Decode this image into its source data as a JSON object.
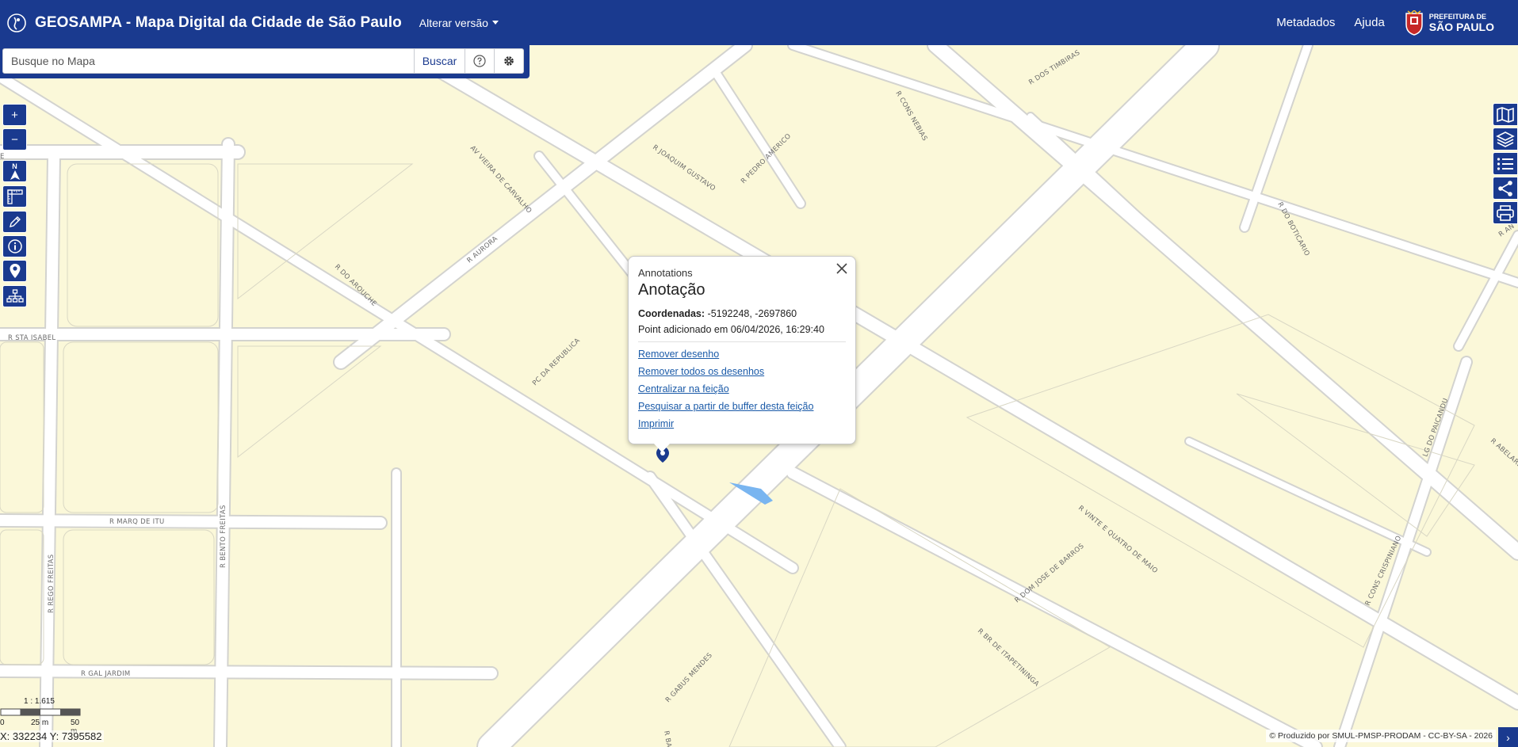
{
  "header": {
    "title": "GEOSAMPA - Mapa Digital da Cidade de São Paulo",
    "version_menu": "Alterar versão",
    "nav": {
      "metadados": "Metadados",
      "ajuda": "Ajuda"
    },
    "logo_line1": "PREFEITURA DE",
    "logo_line2": "SÃO PAULO",
    "brand_color": "#1a3a8f"
  },
  "search": {
    "placeholder": "Busque no Mapa",
    "button_label": "Buscar",
    "help_icon": "question-circle-icon",
    "settings_icon": "gear-icon"
  },
  "toolbar_left": {
    "zoom_in": "+",
    "zoom_out": "−",
    "north_label": "N",
    "tools": [
      "north-arrow-icon",
      "ruler-icon",
      "pencil-icon",
      "info-icon",
      "map-pin-icon",
      "sitemap-icon"
    ]
  },
  "toolbar_right": {
    "tools": [
      "map-icon",
      "layers-icon",
      "list-icon",
      "share-icon",
      "printer-icon"
    ]
  },
  "streets": [
    "R CONS NEBIAS",
    "R DOS TIMBIRAS",
    "AV VIEIRA DE CARVALHO",
    "R JOAQUIM GUSTAVO",
    "R PEDRO AMERICO",
    "R AURORA",
    "R DO AROUCHE",
    "R STA ISABEL",
    "PC DA REPUBLICA",
    "R DO BOTICARIO",
    "R MARQ DE ITU",
    "R BENTO FREITAS",
    "R REGO FREITAS",
    "R GAL JARDIM",
    "R GABUS MENDES",
    "R DOM JOSE DE BARROS",
    "R VINTE E QUATRO DE MAIO",
    "R BR DE ITAPETININGA",
    "R CONS CRISPINIANO",
    "LG DO PAICANDU",
    "R ABELARDO",
    "R AN",
    "E",
    "R BA"
  ],
  "popup": {
    "subtitle": "Annotations",
    "title": "Anotação",
    "coords_label": "Coordenadas:",
    "coords_value": "-5192248, -2697860",
    "added_text": "Point adicionado em 06/04/2026, 16:29:40",
    "links": [
      "Remover desenho",
      "Remover todos os desenhos",
      "Centralizar na feição",
      "Pesquisar a partir de buffer desta feição",
      "Imprimir"
    ]
  },
  "scale": {
    "ratio": "1 : 1.615",
    "tick0": "0",
    "tick1": "25 m",
    "tick2": "50 m"
  },
  "coordinates": "X: 332234 Y: 7395582",
  "attribution": "© Produzido por SMUL-PMSP-PRODAM - CC-BY-SA - 2026",
  "attribution_toggle": "›"
}
